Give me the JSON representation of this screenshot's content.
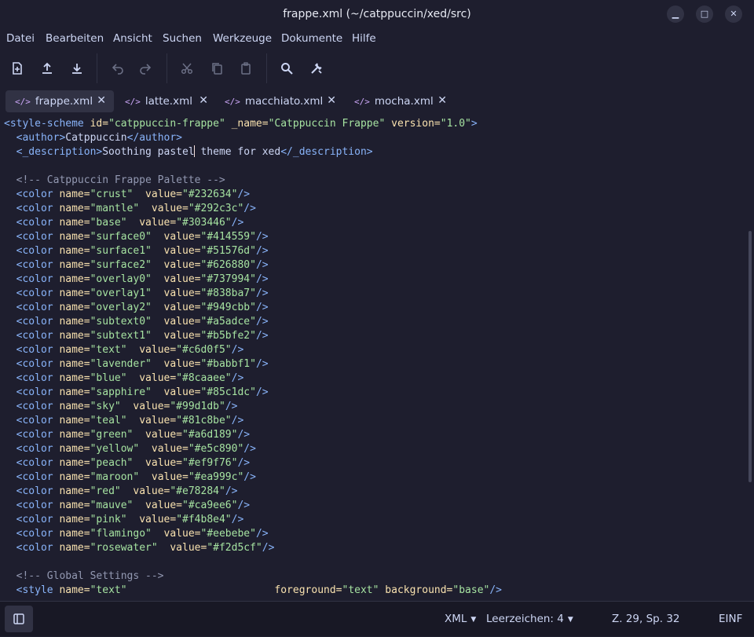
{
  "window": {
    "title": "frappe.xml (~/catppuccin/xed/src)",
    "minimize_glyph": "▁",
    "maximize_glyph": "□",
    "close_glyph": "✕"
  },
  "menu": [
    "Datei",
    "Bearbeiten",
    "Ansicht",
    "Suchen",
    "Werkzeuge",
    "Dokumente",
    "Hilfe"
  ],
  "toolbar": {
    "buttons": [
      "new-document-icon",
      "open-upload-icon",
      "save-download-icon",
      "undo-icon",
      "redo-icon",
      "cut-icon",
      "copy-icon",
      "paste-icon",
      "search-icon",
      "tools-icon"
    ]
  },
  "tabs": [
    {
      "icon": "</>",
      "label": "frappe.xml",
      "close": "✕",
      "active": true
    },
    {
      "icon": "</>",
      "label": "latte.xml",
      "close": "✕",
      "active": false
    },
    {
      "icon": "</>",
      "label": "macchiato.xml",
      "close": "✕",
      "active": false
    },
    {
      "icon": "</>",
      "label": "mocha.xml",
      "close": "✕",
      "active": false
    }
  ],
  "editor": {
    "line1": {
      "open": "<style-scheme",
      "a1": " id=",
      "v1": "\"catppuccin-frappe\"",
      "a2": " _name=",
      "v2": "\"Catppuccin Frappe\"",
      "a3": " version=",
      "v3": "\"1.0\"",
      "close": ">"
    },
    "line2": {
      "open": "  <author>",
      "text": "Catppuccin",
      "close": "</author>"
    },
    "line3": {
      "open": "  <_description>",
      "text_before": "Soothing pastel",
      "text_after": " theme for xed",
      "close": "</_description>"
    },
    "comment_palette": "  <!-- Catppuccin Frappe Palette -->",
    "colors": [
      {
        "name": "\"crust\"",
        "gap": "  ",
        "value": "\"#232634\""
      },
      {
        "name": "\"mantle\"",
        "gap": "  ",
        "value": "\"#292c3c\""
      },
      {
        "name": "\"base\"",
        "gap": "  ",
        "value": "\"#303446\""
      },
      {
        "name": "\"surface0\"",
        "gap": "  ",
        "value": "\"#414559\""
      },
      {
        "name": "\"surface1\"",
        "gap": "  ",
        "value": "\"#51576d\""
      },
      {
        "name": "\"surface2\"",
        "gap": "  ",
        "value": "\"#626880\""
      },
      {
        "name": "\"overlay0\"",
        "gap": "  ",
        "value": "\"#737994\""
      },
      {
        "name": "\"overlay1\"",
        "gap": "  ",
        "value": "\"#838ba7\""
      },
      {
        "name": "\"overlay2\"",
        "gap": "  ",
        "value": "\"#949cbb\""
      },
      {
        "name": "\"subtext0\"",
        "gap": "  ",
        "value": "\"#a5adce\""
      },
      {
        "name": "\"subtext1\"",
        "gap": "  ",
        "value": "\"#b5bfe2\""
      },
      {
        "name": "\"text\"",
        "gap": "  ",
        "value": "\"#c6d0f5\""
      },
      {
        "name": "\"lavender\"",
        "gap": "  ",
        "value": "\"#babbf1\""
      },
      {
        "name": "\"blue\"",
        "gap": "  ",
        "value": "\"#8caaee\""
      },
      {
        "name": "\"sapphire\"",
        "gap": "  ",
        "value": "\"#85c1dc\""
      },
      {
        "name": "\"sky\"",
        "gap": "  ",
        "value": "\"#99d1db\""
      },
      {
        "name": "\"teal\"",
        "gap": "  ",
        "value": "\"#81c8be\""
      },
      {
        "name": "\"green\"",
        "gap": "  ",
        "value": "\"#a6d189\""
      },
      {
        "name": "\"yellow\"",
        "gap": "  ",
        "value": "\"#e5c890\""
      },
      {
        "name": "\"peach\"",
        "gap": "  ",
        "value": "\"#ef9f76\""
      },
      {
        "name": "\"maroon\"",
        "gap": "  ",
        "value": "\"#ea999c\""
      },
      {
        "name": "\"red\"",
        "gap": "  ",
        "value": "\"#e78284\""
      },
      {
        "name": "\"mauve\"",
        "gap": "  ",
        "value": "\"#ca9ee6\""
      },
      {
        "name": "\"pink\"",
        "gap": "  ",
        "value": "\"#f4b8e4\""
      },
      {
        "name": "\"flamingo\"",
        "gap": "  ",
        "value": "\"#eebebe\""
      },
      {
        "name": "\"rosewater\"",
        "gap": "  ",
        "value": "\"#f2d5cf\""
      }
    ],
    "color_tag": "  <color",
    "name_attr": " name=",
    "value_attr": "value=",
    "self_close": "/>",
    "comment_global": "  <!-- Global Settings -->",
    "last": {
      "open": "  <style",
      "a1": " name=",
      "v1": "\"text\"",
      "pad": "                        ",
      "a2": "foreground=",
      "v2": "\"text\"",
      "a3": " background=",
      "v3": "\"base\"",
      "close": "/>"
    }
  },
  "statusbar": {
    "language": "XML",
    "indent": "Leerzeichen: 4",
    "position": "Z. 29, Sp. 32",
    "mode": "EINF",
    "caret": "▼"
  },
  "colors": {
    "background": "#1e1e2e",
    "tag": "#89b4fa",
    "attribute": "#f9e2af",
    "string": "#a6e3a1",
    "comment": "#9399b2",
    "tab_icon": "#cba6f7"
  }
}
